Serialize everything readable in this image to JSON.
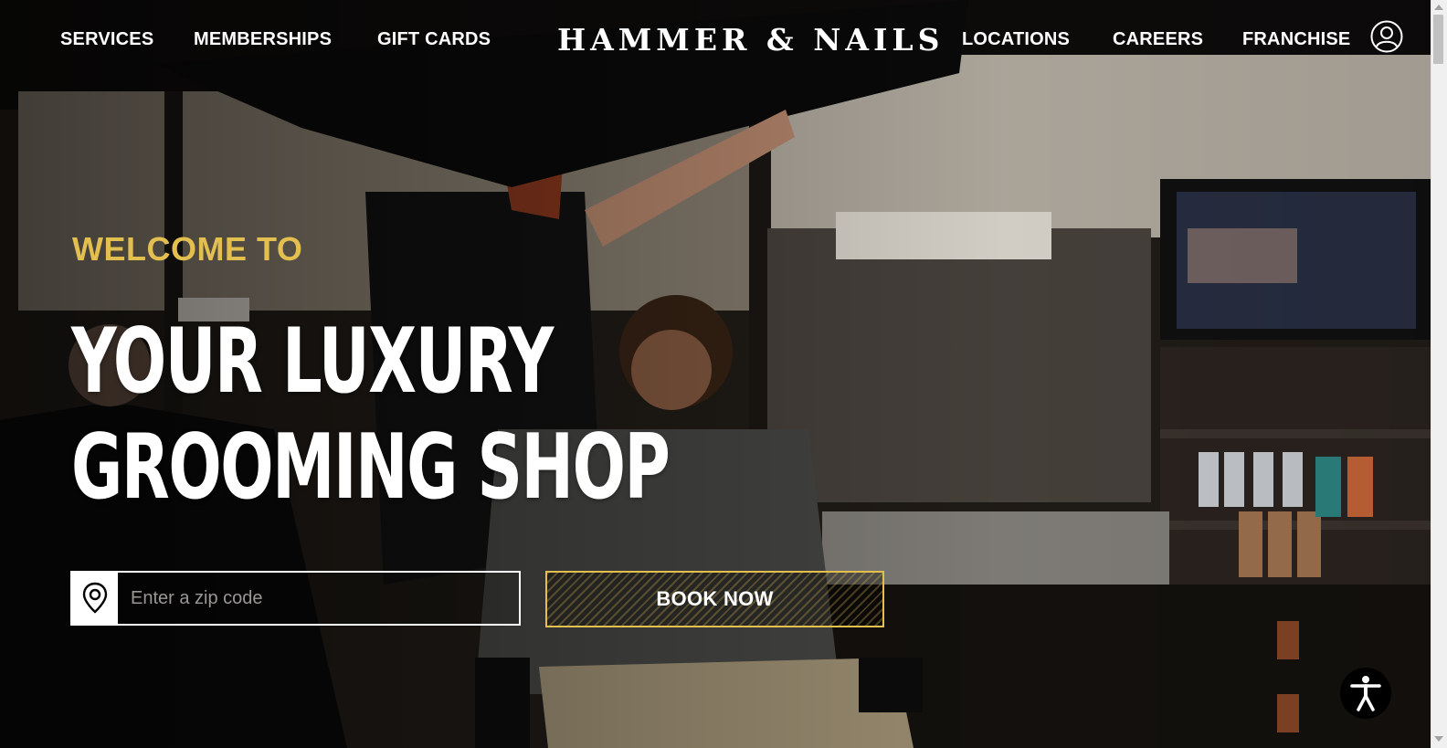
{
  "nav": {
    "services": "SERVICES",
    "memberships": "MEMBERSHIPS",
    "gift_cards": "GIFT CARDS",
    "logo": "HAMMER & NAILS",
    "locations": "LOCATIONS",
    "careers": "CAREERS",
    "franchise": "FRANCHISE",
    "account_icon": "user-circle-icon"
  },
  "hero": {
    "welcome": "WELCOME TO",
    "headline_line1": "YOUR LUXURY",
    "headline_line2": "GROOMING SHOP"
  },
  "search": {
    "placeholder": "Enter a zip code",
    "value": "",
    "icon": "map-pin-icon"
  },
  "cta": {
    "book_now": "BOOK NOW"
  },
  "accessibility": {
    "icon": "accessibility-icon"
  },
  "colors": {
    "accent_gold": "#e3bf4f",
    "nav_text": "#ffffff"
  }
}
